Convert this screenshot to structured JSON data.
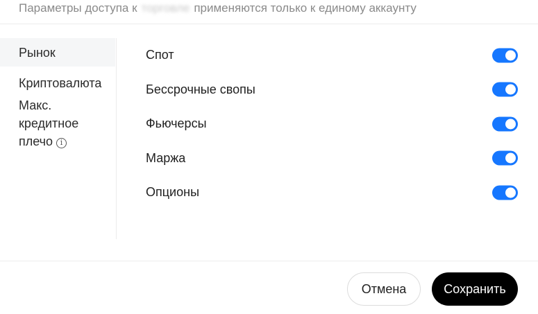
{
  "header": {
    "note_before": "Параметры доступа к",
    "note_blurred": "торговле",
    "note_after": "применяются только к единому аккаунту"
  },
  "sidebar": {
    "items": [
      {
        "label": "Рынок",
        "active": true
      },
      {
        "label": "Криптовалюта",
        "active": false
      },
      {
        "label": "Макс. кредитное плечо",
        "active": false
      }
    ]
  },
  "options": [
    {
      "label": "Спот",
      "enabled": true
    },
    {
      "label": "Бессрочные свопы",
      "enabled": true
    },
    {
      "label": "Фьючерсы",
      "enabled": true
    },
    {
      "label": "Маржа",
      "enabled": true
    },
    {
      "label": "Опционы",
      "enabled": true
    }
  ],
  "footer": {
    "cancel_label": "Отмена",
    "save_label": "Сохранить"
  },
  "colors": {
    "toggle_on": "#1677ff",
    "save_button": "#000000"
  },
  "icons": {
    "info": "info-icon"
  }
}
